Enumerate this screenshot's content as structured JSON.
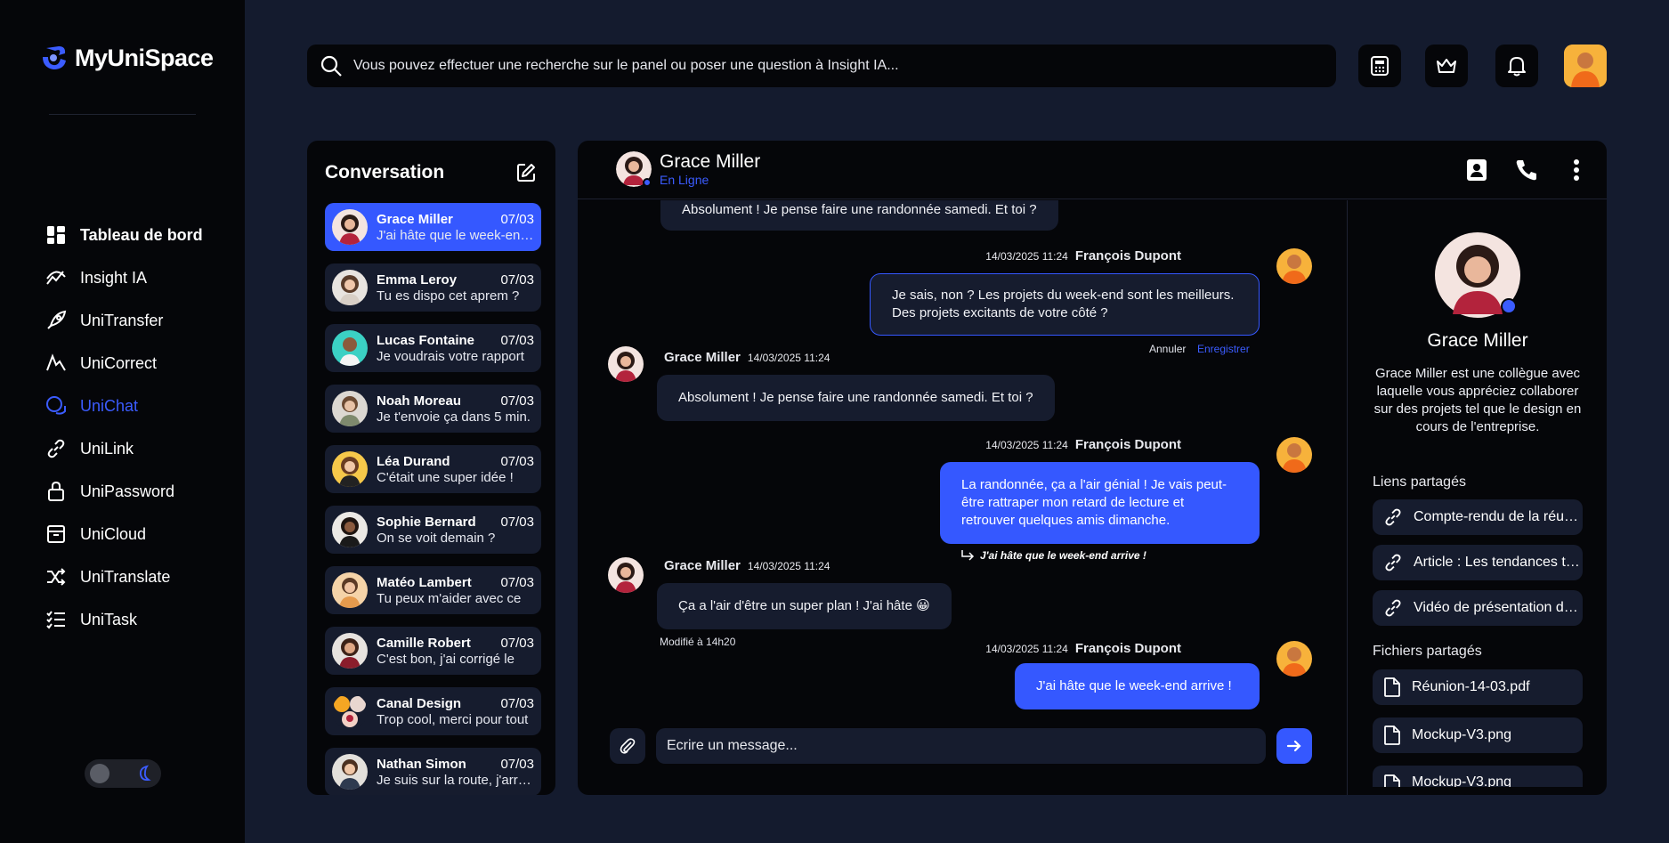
{
  "app": {
    "name": "MyUniSpace"
  },
  "nav": {
    "items": [
      {
        "label": "Tableau de bord",
        "icon": "dashboard-icon"
      },
      {
        "label": "Insight IA",
        "icon": "insight-icon"
      },
      {
        "label": "UniTransfer",
        "icon": "rocket-icon"
      },
      {
        "label": "UniCorrect",
        "icon": "correct-icon"
      },
      {
        "label": "UniChat",
        "icon": "chat-icon"
      },
      {
        "label": "UniLink",
        "icon": "link-icon"
      },
      {
        "label": "UniPassword",
        "icon": "lock-icon"
      },
      {
        "label": "UniCloud",
        "icon": "archive-icon"
      },
      {
        "label": "UniTranslate",
        "icon": "shuffle-icon"
      },
      {
        "label": "UniTask",
        "icon": "tasklist-icon"
      }
    ],
    "active": "UniChat"
  },
  "search": {
    "placeholder": "Vous pouvez effectuer une recherche sur le panel ou poser une question à Insight IA..."
  },
  "conversations": {
    "title": "Conversation",
    "items": [
      {
        "name": "Grace Miller",
        "date": "07/03",
        "preview": "J'ai hâte que le week-end arrive !"
      },
      {
        "name": "Emma Leroy",
        "date": "07/03",
        "preview": "Tu es dispo cet aprem ?"
      },
      {
        "name": "Lucas Fontaine",
        "date": "07/03",
        "preview": "Je voudrais votre rapport"
      },
      {
        "name": "Noah Moreau",
        "date": "07/03",
        "preview": "Je t'envoie ça dans 5 min."
      },
      {
        "name": "Léa Durand",
        "date": "07/03",
        "preview": "C'était une super idée !"
      },
      {
        "name": "Sophie Bernard",
        "date": "07/03",
        "preview": "On se voit demain ?"
      },
      {
        "name": "Matéo Lambert",
        "date": "07/03",
        "preview": "Tu peux m'aider avec ce"
      },
      {
        "name": "Camille Robert",
        "date": "07/03",
        "preview": "C'est bon, j'ai corrigé le"
      },
      {
        "name": "Canal Design",
        "date": "07/03",
        "preview": "Trop cool, merci pour tout"
      },
      {
        "name": "Nathan Simon",
        "date": "07/03",
        "preview": "Je suis sur la route, j'arrive"
      }
    ]
  },
  "chat": {
    "contact_name": "Grace Miller",
    "contact_status": "En Ligne",
    "messages": {
      "m0": {
        "text": "Absolument ! Je pense faire une randonnée samedi. Et toi ?"
      },
      "m1": {
        "author": "François Dupont",
        "time": "14/03/2025 11:24",
        "line1": "Je sais, non ? Les projets du week-end sont les meilleurs.",
        "line2": "Des projets excitants de votre côté ?",
        "cancel": "Annuler",
        "save": "Enregistrer"
      },
      "m2": {
        "author": "Grace Miller",
        "time": "14/03/2025 11:24",
        "text": "Absolument ! Je pense faire une randonnée samedi. Et toi ?"
      },
      "m3": {
        "author": "François Dupont",
        "time": "14/03/2025 11:24",
        "line1": "La randonnée, ça a l'air génial ! Je vais peut-",
        "line2": "être rattraper mon retard de lecture et",
        "line3": "retrouver quelques amis dimanche.",
        "reply": "J'ai hâte que le week-end arrive !"
      },
      "m4": {
        "author": "Grace Miller",
        "time": "14/03/2025 11:24",
        "text": "Ça a l'air d'être un super plan ! J'ai hâte 😀",
        "edited": "Modifié à 14h20"
      },
      "m5": {
        "author": "François Dupont",
        "time": "14/03/2025 11:24",
        "text": "J'ai hâte que le week-end arrive !"
      }
    },
    "composer_placeholder": "Ecrire un message..."
  },
  "info": {
    "name": "Grace Miller",
    "description": "Grace Miller est une collègue avec laquelle vous appréciez collaborer sur des projets tel que le design en cours de l'entreprise.",
    "links_title": "Liens partagés",
    "links": [
      "Compte-rendu de la réunion",
      "Article : Les tendances tech",
      "Vidéo de présentation du projet"
    ],
    "files_title": "Fichiers partagés",
    "files": [
      "Réunion-14-03.pdf",
      "Mockup-V3.png",
      "Mockup-V3.png"
    ]
  },
  "colors": {
    "accent": "#3558ff",
    "background": "#141b2e",
    "panel": "#050609",
    "bubble": "#161c2e"
  }
}
